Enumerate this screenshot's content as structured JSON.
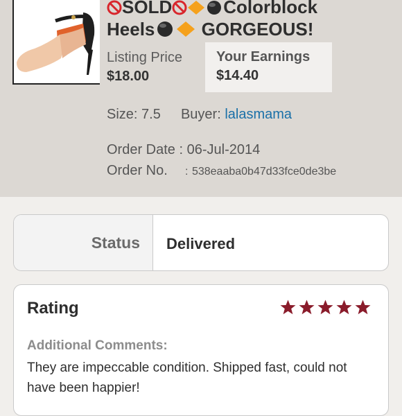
{
  "listing": {
    "title_line1_text": "SOLD",
    "title_line1_tail": "Colorblock",
    "title_line2_text": "Heels",
    "title_line2_tail": "GORGEOUS!",
    "listing_price_label": "Listing Price",
    "listing_price": "$18.00",
    "earnings_label": "Your Earnings",
    "earnings": "$14.40"
  },
  "details": {
    "size_label": "Size:",
    "size": "7.5",
    "buyer_label": "Buyer:",
    "buyer": "lalasmama",
    "order_date_label": "Order Date :",
    "order_date": "06-Jul-2014",
    "order_no_label": "Order No.",
    "order_no_sep": ":",
    "order_no": "538eaaba0b47d33fce0de3be"
  },
  "status": {
    "label": "Status",
    "value": "Delivered"
  },
  "rating": {
    "title": "Rating",
    "stars": 5,
    "comments_label": "Additional Comments:",
    "comments": "They are impeccable condition. Shipped fast, could not have been happier!"
  },
  "icons": [
    "no-entry-icon",
    "orange-diamond-icon",
    "black-circle-icon",
    "star-icon"
  ],
  "colors": {
    "star": "#8a1c2b",
    "buyer_link": "#1a70a8",
    "no_entry": "#d8262c",
    "diamond": "#f5a11c"
  }
}
